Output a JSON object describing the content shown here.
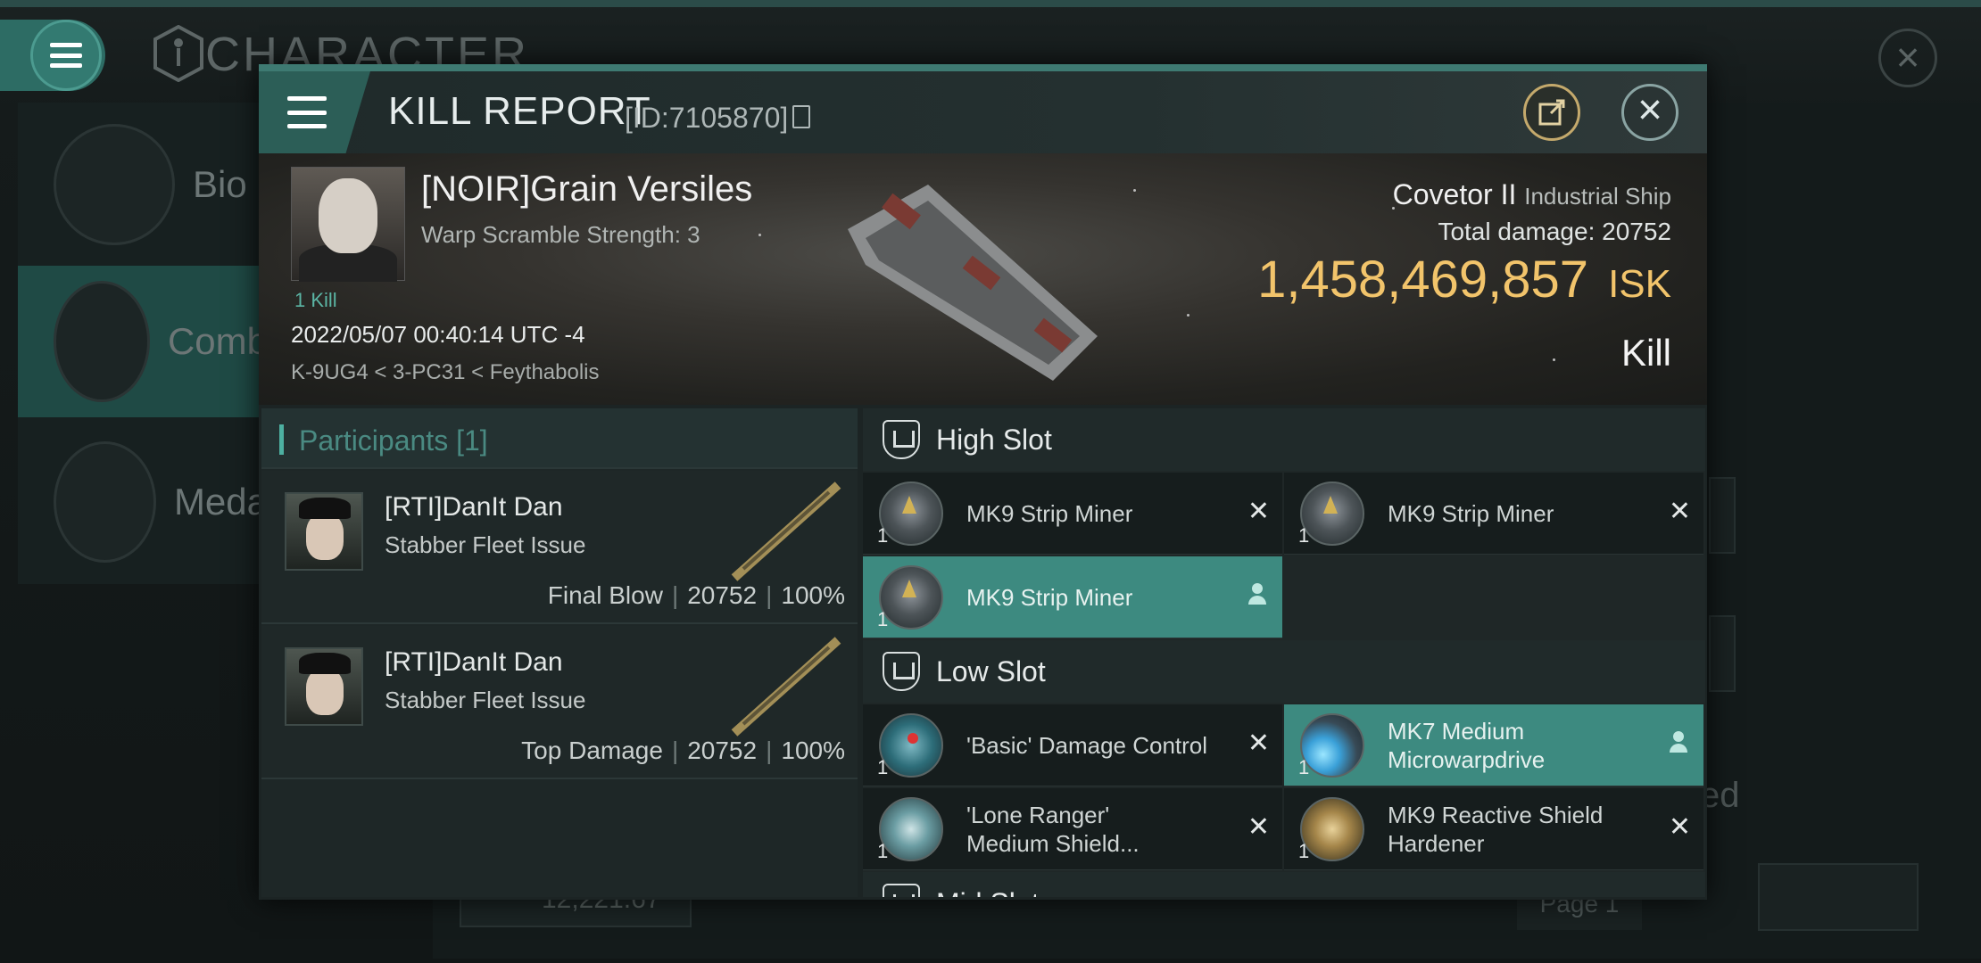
{
  "background": {
    "title": "CHARACTER",
    "nav": [
      {
        "label": "Bio",
        "icon": "list-icon"
      },
      {
        "label": "Comb",
        "icon": "crossed-swords-icon"
      },
      {
        "label": "Meda",
        "icon": "star-badge-icon"
      }
    ],
    "bottom_value": "12,221.67",
    "page_label": "Page 1",
    "side_text": "ed"
  },
  "modal": {
    "title": "KILL REPORT",
    "id_text": "[ID:7105870]",
    "victim": {
      "name": "[NOIR]Grain Versiles",
      "scramble": "Warp Scramble Strength: 3",
      "kills": "1 Kill",
      "time": "2022/05/07 00:40:14 UTC -4",
      "location": "K-9UG4 < 3-PC31 < Feythabolis"
    },
    "ship": {
      "name": "Covetor II",
      "class": "Industrial Ship",
      "damage_label": "Total damage:",
      "damage_value": "20752",
      "isk_value": "1,458,469,857",
      "isk_unit": "ISK",
      "result": "Kill"
    },
    "participants": {
      "header": "Participants [1]",
      "rows": [
        {
          "name": "[RTI]DanIt Dan",
          "ship": "Stabber Fleet Issue",
          "tag": "Final Blow",
          "damage": "20752",
          "percent": "100%"
        },
        {
          "name": "[RTI]DanIt Dan",
          "ship": "Stabber Fleet Issue",
          "tag": "Top Damage",
          "damage": "20752",
          "percent": "100%"
        }
      ]
    },
    "slots": {
      "high_label": "High Slot",
      "low_label": "Low Slot",
      "mid_label": "Mid Slot",
      "high": [
        {
          "name": "MK9 Strip Miner",
          "qty": "1",
          "state": "destroyed",
          "icon": "strip-miner-icon"
        },
        {
          "name": "MK9 Strip Miner",
          "qty": "1",
          "state": "destroyed",
          "icon": "strip-miner-icon"
        },
        {
          "name": "MK9 Strip Miner",
          "qty": "1",
          "state": "dropped",
          "icon": "strip-miner-icon"
        }
      ],
      "low": [
        {
          "name": "'Basic' Damage Control",
          "qty": "1",
          "state": "destroyed",
          "icon": "damage-control-icon"
        },
        {
          "name": "MK7 Medium Microwarpdrive",
          "qty": "1",
          "state": "dropped",
          "icon": "microwarpdrive-icon"
        },
        {
          "name": "'Lone Ranger' Medium Shield...",
          "qty": "1",
          "state": "destroyed",
          "icon": "shield-extender-icon"
        },
        {
          "name": "MK9 Reactive Shield Hardener",
          "qty": "1",
          "state": "destroyed",
          "icon": "shield-hardener-icon"
        }
      ]
    },
    "colors": {
      "accent": "#3d8a80",
      "isk": "#f2c46b",
      "share_ring": "#c4a96c"
    }
  }
}
